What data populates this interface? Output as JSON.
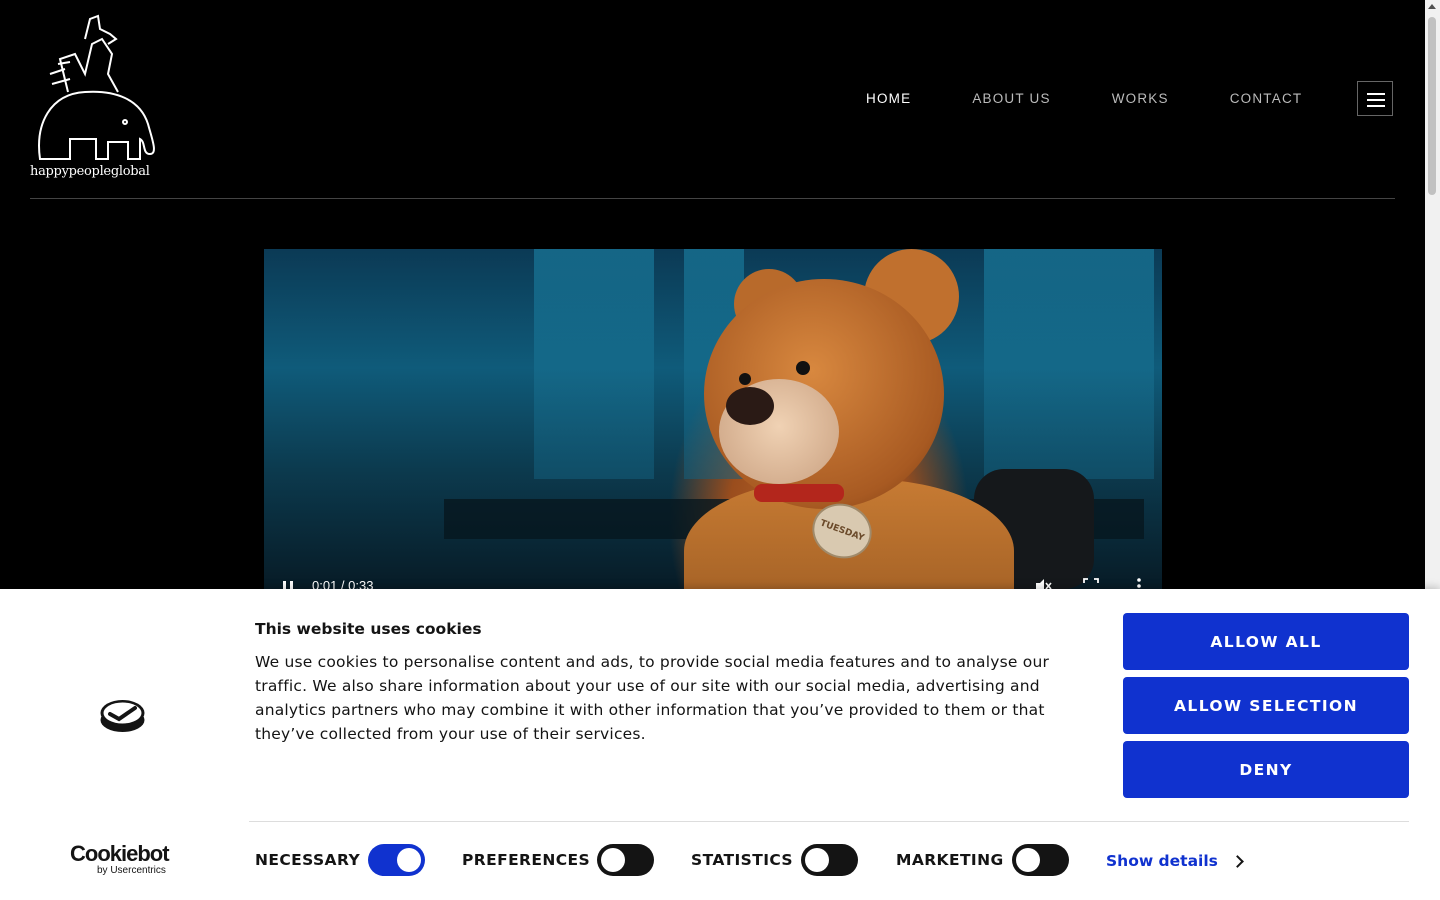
{
  "brand": {
    "logo_text": "happypeopleglobal"
  },
  "nav": {
    "items": [
      {
        "label": "HOME",
        "active": true
      },
      {
        "label": "ABOUT US",
        "active": false
      },
      {
        "label": "WORKS",
        "active": false
      },
      {
        "label": "CONTACT",
        "active": false
      }
    ],
    "menu_icon": "hamburger-icon"
  },
  "video": {
    "time": "0:01 / 0:33",
    "badge_text": "TUESDAY",
    "icons": [
      "pause-icon",
      "muted-icon",
      "fullscreen-icon",
      "more-options-icon"
    ]
  },
  "cookie_banner": {
    "title": "This website uses cookies",
    "text": "We use cookies to personalise content and ads, to provide social media features and to analyse our traffic. We also share information about your use of our site with our social media, advertising and analytics partners who may combine it with other information that you’ve provided to them or that they’ve collected from your use of their services.",
    "buttons": {
      "allow_all": "ALLOW ALL",
      "allow_selection": "ALLOW SELECTION",
      "deny": "DENY"
    },
    "brand_name": "Cookiebot",
    "brand_sub": "by Usercentrics",
    "categories": [
      {
        "label": "NECESSARY",
        "on": true
      },
      {
        "label": "PREFERENCES",
        "on": false
      },
      {
        "label": "STATISTICS",
        "on": false
      },
      {
        "label": "MARKETING",
        "on": false
      }
    ],
    "show_details": "Show details",
    "accent_color": "#1032cf"
  }
}
